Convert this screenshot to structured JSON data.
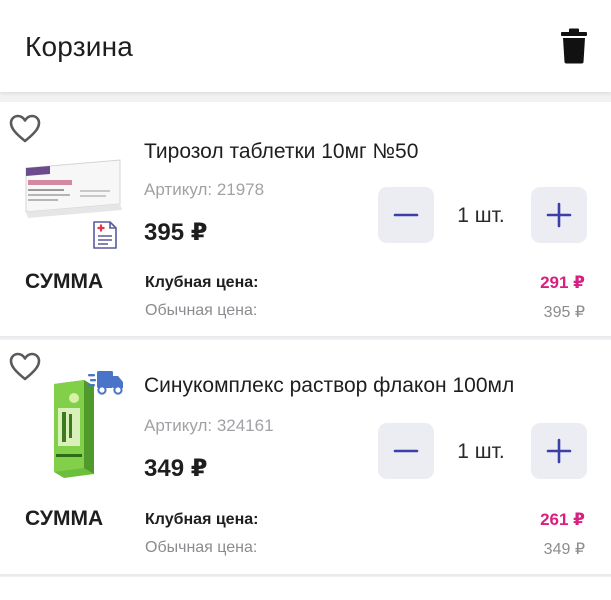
{
  "header": {
    "title": "Корзина",
    "trash_icon": "trash-icon"
  },
  "cart": {
    "items": [
      {
        "name": "Тирозол таблетки 10мг №50",
        "sku": "Артикул: 21978",
        "price": "395 ₽",
        "quantity": "1 шт.",
        "sum_label": "СУММА",
        "club_label": "Клубная цена:",
        "club_price": "291 ₽",
        "regular_label": "Обычная цена:",
        "regular_price": "395 ₽",
        "badge_icon": "prescription-icon",
        "box_text": "Тирозол 10 мг"
      },
      {
        "name": "Синукомплекс раствор флакон 100мл",
        "sku": "Артикул: 324161",
        "price": "349 ₽",
        "quantity": "1 шт.",
        "sum_label": "СУММА",
        "club_label": "Клубная цена:",
        "club_price": "261 ₽",
        "regular_label": "Обычная цена:",
        "regular_price": "349 ₽",
        "badge_icon": "delivery-truck-icon",
        "box_text": "Синукомплекс"
      }
    ]
  },
  "colors": {
    "accent": "#3d3fa8",
    "club_price": "#d7207f",
    "button_bg": "#ececf3",
    "page_bg": "#f2f2f4"
  }
}
